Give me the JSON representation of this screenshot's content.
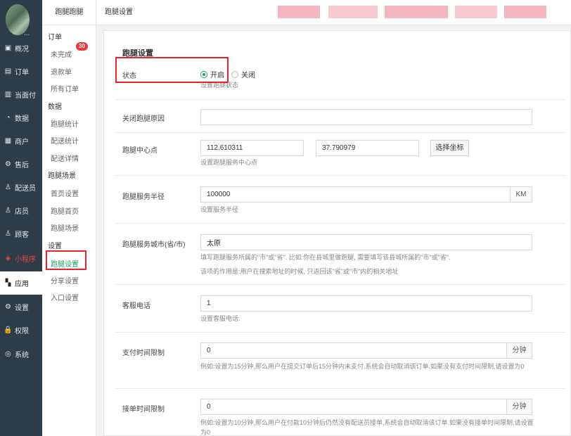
{
  "nav": {
    "avatar_dots": "...",
    "items": [
      {
        "icon": "▣",
        "label": "概况"
      },
      {
        "icon": "▤",
        "label": "订单"
      },
      {
        "icon": "▥",
        "label": "当面付"
      },
      {
        "icon": "◔",
        "label": "数据"
      },
      {
        "icon": "▦",
        "label": "商户"
      },
      {
        "icon": "⚙",
        "label": "售后"
      },
      {
        "icon": "♙",
        "label": "配送员"
      },
      {
        "icon": "♙",
        "label": "店员"
      },
      {
        "icon": "♙",
        "label": "顾客"
      },
      {
        "icon": "◈",
        "label": "小程序"
      },
      {
        "icon": "▚",
        "label": "应用"
      },
      {
        "icon": "⚙",
        "label": "设置"
      },
      {
        "icon": "🔒",
        "label": "权限"
      },
      {
        "icon": "◎",
        "label": "系统"
      }
    ]
  },
  "subnav": {
    "title": "跑腿跑腿",
    "group_order": "订单",
    "unfinished": "未完成",
    "unfinished_badge": "30",
    "refund": "退款单",
    "all_orders": "所有订单",
    "group_data": "数据",
    "errand_stats": "跑腿统计",
    "delivery_stats": "配送统计",
    "delivery_detail": "配送详情",
    "group_scene": "跑腿场景",
    "home_settings": "首页设置",
    "errand_home": "跑腿首页",
    "errand_scene": "跑腿场景",
    "group_settings": "设置",
    "errand_settings": "跑腿设置",
    "share_settings": "分享设置",
    "entry_settings": "入口设置"
  },
  "breadcrumb": "跑腿设置",
  "form": {
    "section_title": "跑腿设置",
    "status_label": "状态",
    "status_on": "开启",
    "status_off": "关闭",
    "status_help": "设置跑腿状态",
    "close_reason_label": "关闭跑腿原因",
    "close_reason_value": "",
    "center_label": "跑腿中心点",
    "center_lng": "112.610311",
    "center_lat": "37.790979",
    "pick_coord_button": "选择坐标",
    "center_help": "设置跑腿服务中心点",
    "radius_label": "跑腿服务半径",
    "radius_value": "100000",
    "radius_unit": "KM",
    "radius_help": "设置服务半径",
    "city_label": "跑腿服务城市(省/市)",
    "city_value": "太原",
    "city_help1": "填写跑腿服务所属的\"市\"或\"省\". 比如:你在县城里做跑腿, 需要填写该县城所属的\"市\"或\"省\".",
    "city_help2": "该项的作用是:用户在搜索地址的时候, 只返回该\"省\"或\"市\"内的相关地址",
    "phone_label": "客服电话",
    "phone_value": "1",
    "phone_help": "设置客服电话.",
    "pay_limit_label": "支付时间限制",
    "pay_limit_value": "0",
    "pay_limit_unit": "分钟",
    "pay_limit_help": "例如:设置为15分钟,那么用户在提交订单后15分钟内未支付,系统会自动取消该订单.如果没有支付时间限制,请设置为0",
    "accept_limit_label": "接单时间限制",
    "accept_limit_value": "0",
    "accept_limit_unit": "分钟",
    "accept_limit_help": "例如:设置为10分钟,那么用户在付款10分钟后仍然没有配送员接单,系统会自动取消该订单.如果没有接单时间限制,请设置为0"
  },
  "colors": {
    "sidebar_bg": "#2f3d48",
    "accent_green": "#1a9f6a",
    "highlight_red": "#e8232d",
    "badge_red": "#e8383d"
  }
}
